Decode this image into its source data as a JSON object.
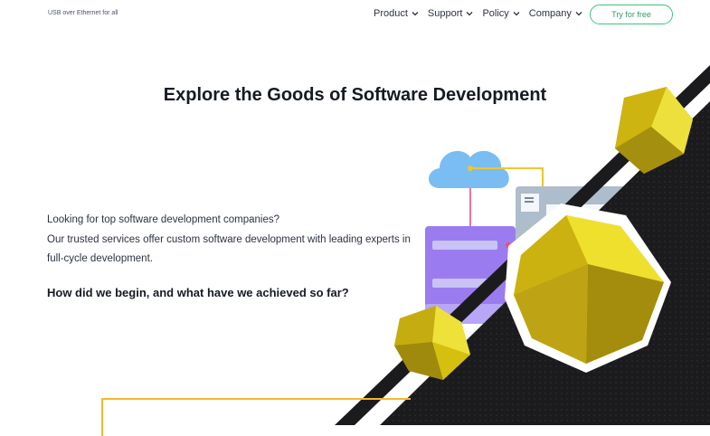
{
  "header": {
    "brand": "USB over Ethernet for all",
    "nav": [
      {
        "label": "Product"
      },
      {
        "label": "Support"
      },
      {
        "label": "Policy"
      },
      {
        "label": "Company"
      }
    ],
    "cta_label": "Try for free"
  },
  "hero": {
    "title": "Explore the Goods of Software Development",
    "lines": [
      "Looking for top software development companies?",
      "Our trusted services offer custom software development with leading experts in",
      "full-cycle development."
    ],
    "question": "How did we begin, and what have we achieved so far?"
  },
  "colors": {
    "accent_green": "#3ac47d",
    "server_purple": "#9c7cf0",
    "cloud_blue": "#6fb6ef",
    "dark_band": "#1b1b1d",
    "gem_yellow": "#e8d21c",
    "outline_orange": "#f5b82e"
  },
  "icons": [
    "chevron-down-icon",
    "cloud-icon",
    "server-icon",
    "window-icon",
    "gem-icon"
  ]
}
